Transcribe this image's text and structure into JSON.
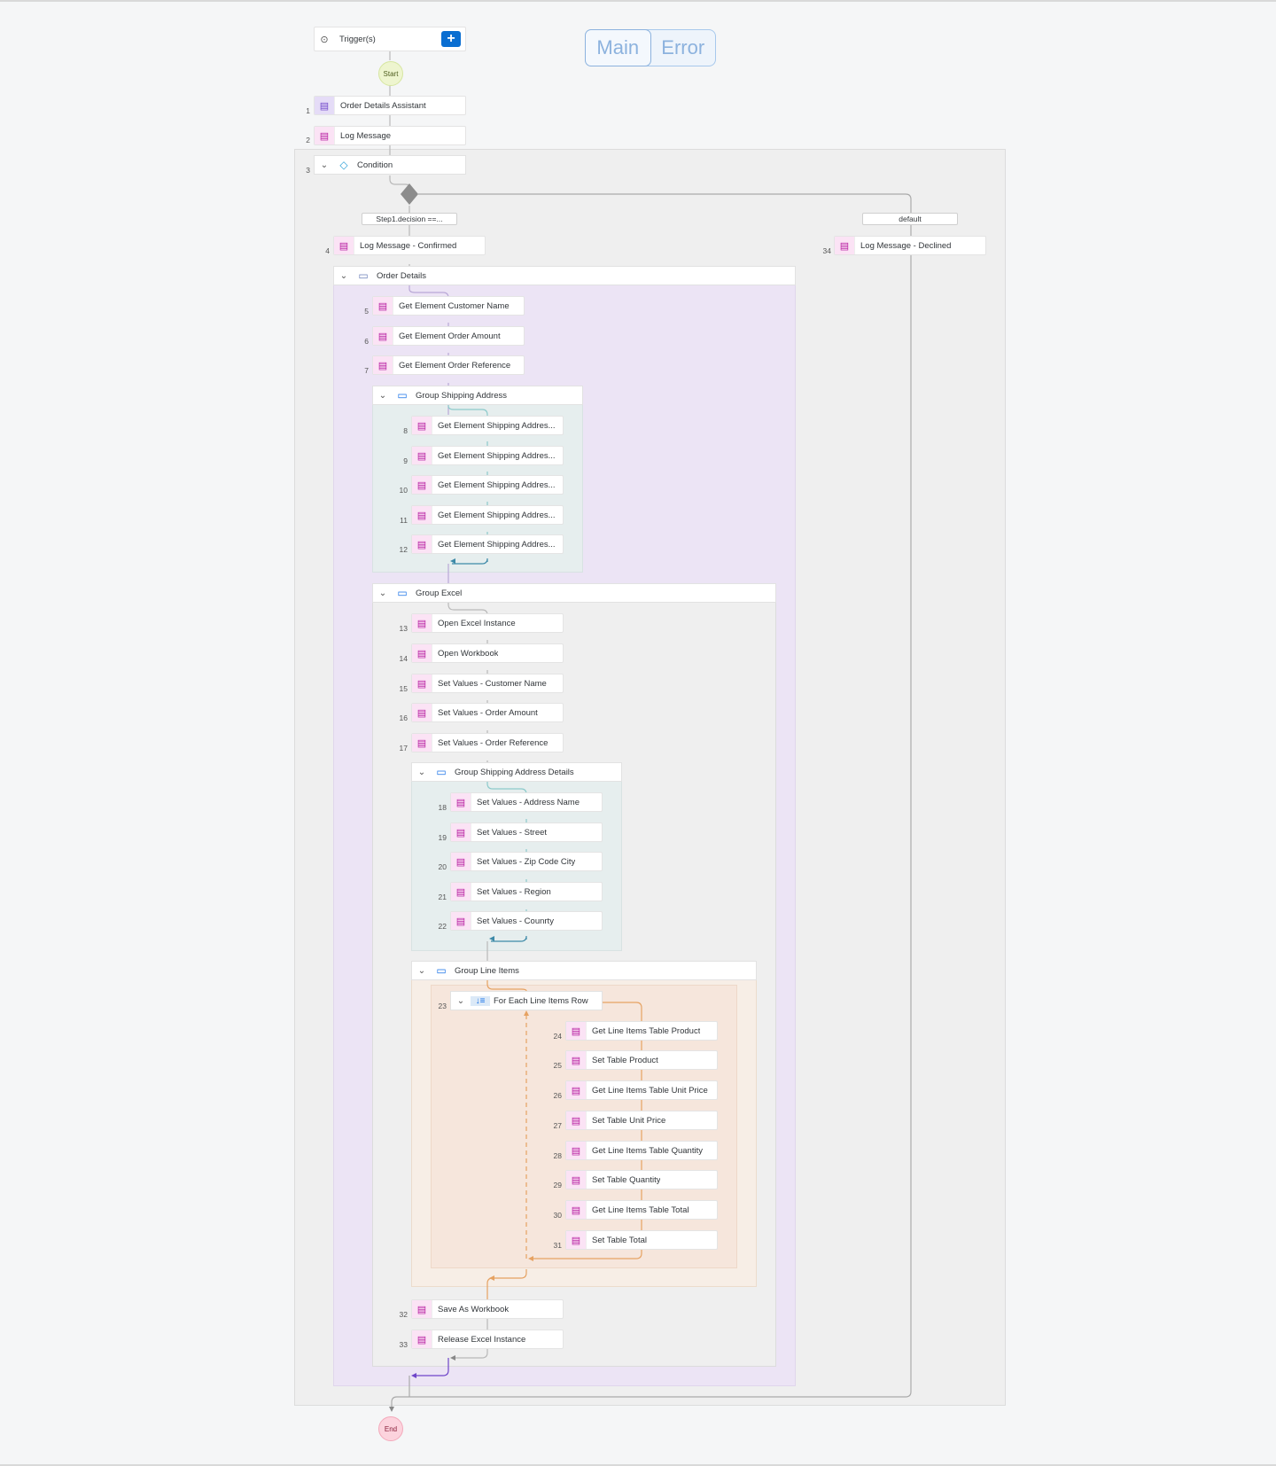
{
  "tabs": {
    "main": "Main",
    "error": "Error",
    "active": "main"
  },
  "trigger": {
    "label": "Trigger(s)",
    "add": "+"
  },
  "start": "Start",
  "end": "End",
  "steps": {
    "s1": {
      "num": "1",
      "label": "Order Details Assistant"
    },
    "s2": {
      "num": "2",
      "label": "Log Message"
    },
    "s3": {
      "num": "3",
      "label": "Condition"
    },
    "branch_left": "Step1.decision ==...",
    "branch_right": "default",
    "s4": {
      "num": "4",
      "label": "Log Message - Confirmed"
    },
    "s34": {
      "num": "34",
      "label": "Log Message - Declined"
    },
    "g_order": {
      "label": "Order Details"
    },
    "s5": {
      "num": "5",
      "label": "Get Element Customer Name"
    },
    "s6": {
      "num": "6",
      "label": "Get Element Order Amount"
    },
    "s7": {
      "num": "7",
      "label": "Get Element Order Reference"
    },
    "g_ship": {
      "label": "Group Shipping Address"
    },
    "s8": {
      "num": "8",
      "label": "Get Element Shipping Addres..."
    },
    "s9": {
      "num": "9",
      "label": "Get Element Shipping Addres..."
    },
    "s10": {
      "num": "10",
      "label": "Get Element Shipping Addres..."
    },
    "s11": {
      "num": "11",
      "label": "Get Element Shipping Addres..."
    },
    "s12": {
      "num": "12",
      "label": "Get Element Shipping Addres..."
    },
    "g_excel": {
      "label": "Group Excel"
    },
    "s13": {
      "num": "13",
      "label": "Open Excel Instance"
    },
    "s14": {
      "num": "14",
      "label": "Open Workbook"
    },
    "s15": {
      "num": "15",
      "label": "Set Values - Customer Name"
    },
    "s16": {
      "num": "16",
      "label": "Set Values - Order Amount"
    },
    "s17": {
      "num": "17",
      "label": "Set Values - Order Reference"
    },
    "g_shipdet": {
      "label": "Group Shipping Address Details"
    },
    "s18": {
      "num": "18",
      "label": "Set Values - Address Name"
    },
    "s19": {
      "num": "19",
      "label": "Set Values - Street"
    },
    "s20": {
      "num": "20",
      "label": "Set Values - Zip Code City"
    },
    "s21": {
      "num": "21",
      "label": "Set Values - Region"
    },
    "s22": {
      "num": "22",
      "label": "Set Values - Counrty"
    },
    "g_line": {
      "label": "Group Line Items"
    },
    "s23": {
      "num": "23",
      "label": "For Each Line Items Row"
    },
    "s24": {
      "num": "24",
      "label": "Get Line Items Table Product"
    },
    "s25": {
      "num": "25",
      "label": "Set Table Product"
    },
    "s26": {
      "num": "26",
      "label": "Get Line Items Table Unit Price"
    },
    "s27": {
      "num": "27",
      "label": "Set Table Unit Price"
    },
    "s28": {
      "num": "28",
      "label": "Get Line Items Table Quantity"
    },
    "s29": {
      "num": "29",
      "label": "Set Table Quantity"
    },
    "s30": {
      "num": "30",
      "label": "Get Line Items Table Total"
    },
    "s31": {
      "num": "31",
      "label": "Set Table Total"
    },
    "s32": {
      "num": "32",
      "label": "Save As Workbook"
    },
    "s33": {
      "num": "33",
      "label": "Release Excel Instance"
    }
  },
  "icons": {
    "activity": "clipboard-icon",
    "group": "folder-icon",
    "condition": "diamond-icon",
    "loop": "loop-icon",
    "trigger": "play-circle-icon",
    "screen": "monitor-icon"
  },
  "colors": {
    "accent": "#0a6ed1",
    "condition_bg": "#efefef",
    "order_group_bg": "#ece4f5",
    "shipping_group_bg": "#e6eeee",
    "excel_group_bg": "#efefef",
    "line_items_bg": "#f7eee6",
    "loop_bg": "#f6e6dc"
  }
}
